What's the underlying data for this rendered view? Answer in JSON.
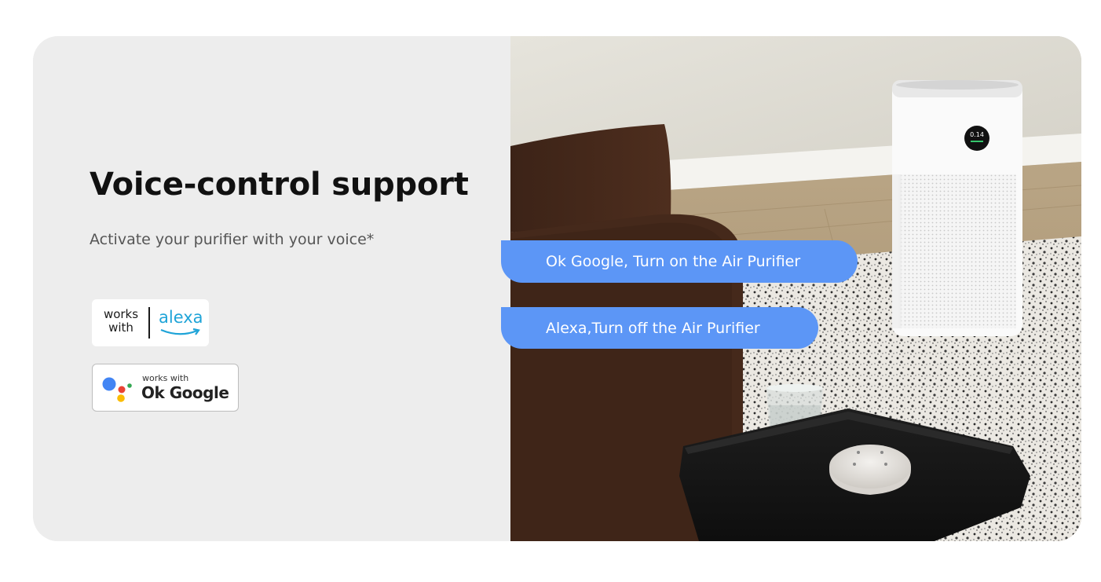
{
  "section": {
    "title": "Voice-control support",
    "subtitle": "Activate your purifier with your voice*"
  },
  "badges": {
    "alexa": {
      "works_with": "works with",
      "brand": "alexa",
      "icon": "alexa-smile-icon",
      "color": "#1fa4d8"
    },
    "google": {
      "works_with": "works with",
      "brand": "Ok Google",
      "icon": "google-assistant-dots-icon",
      "colors": [
        "#4285f4",
        "#ea4335",
        "#fbbc04",
        "#34a853"
      ]
    }
  },
  "bubbles": [
    {
      "text": "Ok Google, Turn on the Air Purifier"
    },
    {
      "text": "Alexa,Turn off the Air Purifier"
    }
  ],
  "photo": {
    "purifier_display": "0.14"
  },
  "colors": {
    "left_panel_bg": "#ededed",
    "bubble_bg": "#5c96f6",
    "title_text": "#111111",
    "subtitle_text": "#555555"
  }
}
